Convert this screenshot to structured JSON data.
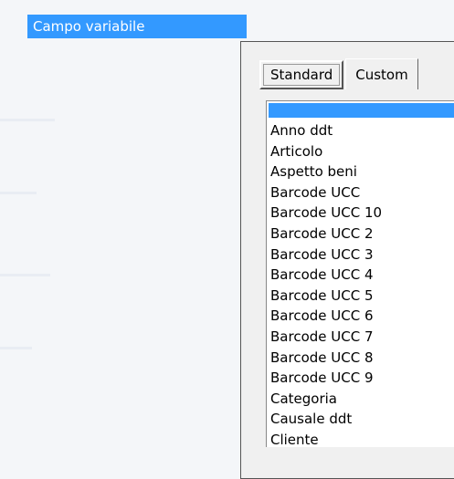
{
  "field": {
    "label": "Campo variabile"
  },
  "tabs": [
    {
      "label": "Standard",
      "active": true
    },
    {
      "label": "Custom",
      "active": false
    }
  ],
  "list": {
    "selected": "",
    "items": [
      "Anno ddt",
      "Articolo",
      "Aspetto beni",
      "Barcode UCC",
      "Barcode UCC 10",
      "Barcode UCC 2",
      "Barcode UCC 3",
      "Barcode UCC 4",
      "Barcode UCC 5",
      "Barcode UCC 6",
      "Barcode UCC 7",
      "Barcode UCC 8",
      "Barcode UCC 9",
      "Categoria",
      "Causale ddt",
      "Cliente"
    ]
  },
  "colors": {
    "selection": "#3399ff",
    "panel": "#f0f0f0"
  }
}
